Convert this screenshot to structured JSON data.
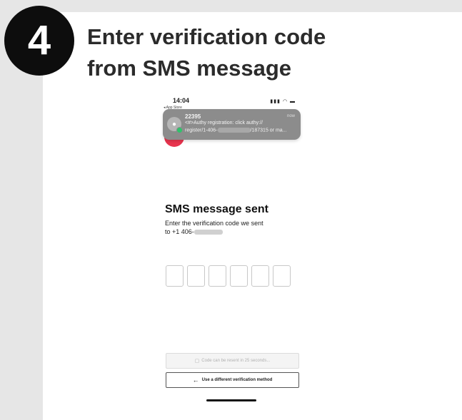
{
  "step": {
    "number": "4",
    "title_line1": "Enter verification code",
    "title_line2": "from SMS message"
  },
  "status_bar": {
    "time": "14:04",
    "back_label": "◂ App Store",
    "icons": "signal-icon wifi-icon battery-icon"
  },
  "notification": {
    "sender": "22395",
    "time": "now",
    "line1": "<#>Authy registration: click authy://",
    "line2_prefix": "register/1-406-",
    "line2_suffix": "/187315 or ma..."
  },
  "sms": {
    "heading": "SMS message sent",
    "desc_line1": "Enter the verification code we sent",
    "desc_line2_prefix": "to +1 406-"
  },
  "code_inputs": [
    "",
    "",
    "",
    "",
    "",
    ""
  ],
  "buttons": {
    "resend": "Code can be resent in 25 seconds...",
    "different_method": "Use a different verification method"
  },
  "colors": {
    "badge": "#0d0d0d",
    "notification_bg": "#8c8c8c",
    "accent_red": "#e8344e",
    "online_dot": "#2fc36b"
  }
}
